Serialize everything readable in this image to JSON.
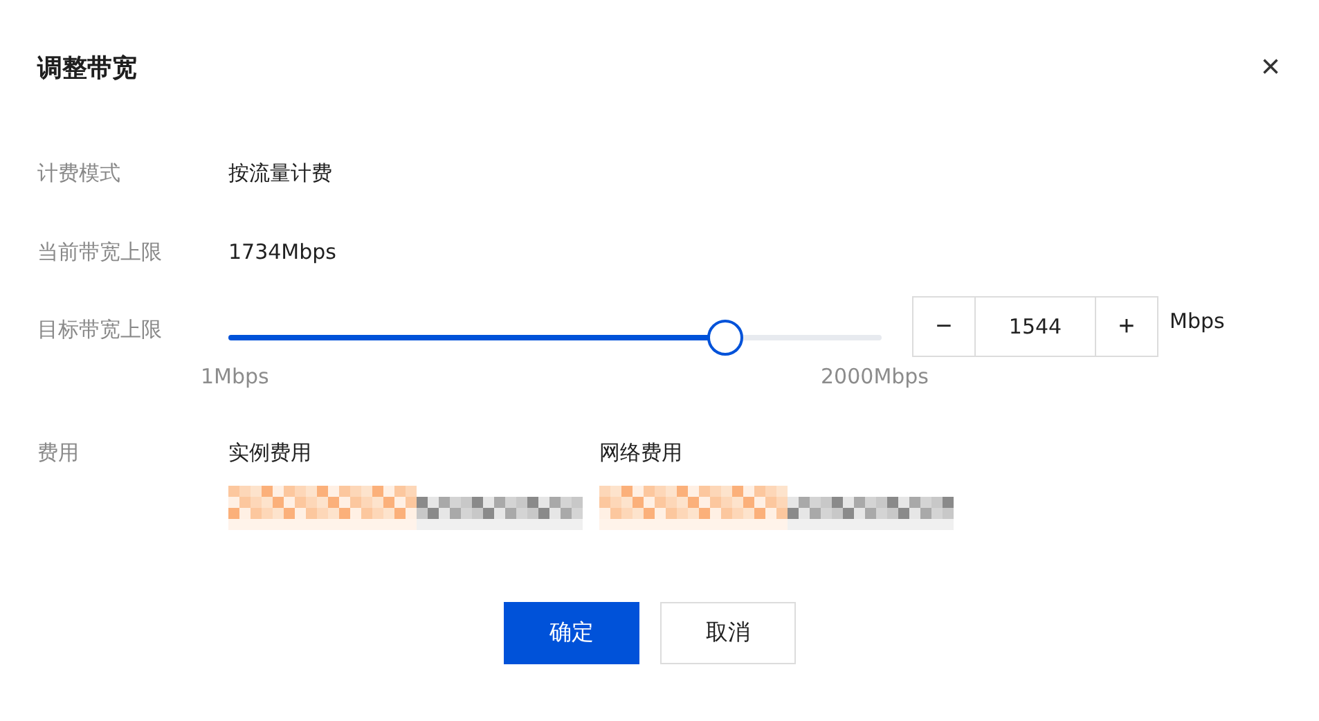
{
  "dialog": {
    "title": "调整带宽",
    "close": "×"
  },
  "fields": [
    {
      "kind": "text",
      "label": "计费模式",
      "value": "按流量计费"
    },
    {
      "kind": "text",
      "label": "当前带宽上限",
      "value": "1734Mbps"
    },
    {
      "kind": "slider",
      "label": "目标带宽上限",
      "level": 0.76,
      "min_label": "1Mbps",
      "max_label": "2000Mbps",
      "stepper": {
        "minus": "−",
        "value": "1544",
        "plus": "+"
      },
      "unit": "Mbps"
    },
    {
      "kind": "cost",
      "label": "费用",
      "columns": [
        {
          "heading": "实例费用"
        },
        {
          "heading": "网络费用"
        }
      ]
    }
  ],
  "buttons": [
    {
      "label": "确定",
      "primary": true
    },
    {
      "label": "取消",
      "primary": false
    }
  ]
}
